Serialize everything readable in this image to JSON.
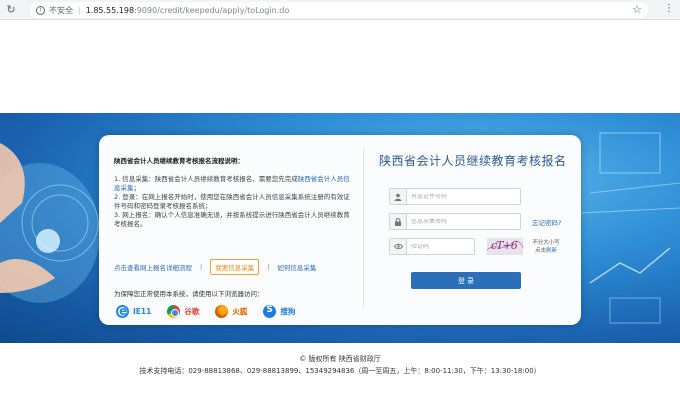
{
  "browser": {
    "security_label": "不安全",
    "url_host": "1.85.55.198",
    "url_path": ":9090/credit/keepedu/apply/toLogin.do"
  },
  "intro": {
    "title": "陕西省会计人员继续教育考核报名流程说明：",
    "steps": [
      {
        "text": "1. 信息采集：陕西省会计人员继续教育考核报名，需要您先完成",
        "link": "陕西省会计人员信息采集",
        "tail": "；"
      },
      {
        "text": "2. 登录：在网上报名开始时，使用您在陕西省会计人员信息采集系统注册的有效证件号码和密码登录考核报名系统；",
        "link": "",
        "tail": ""
      },
      {
        "text": "3. 网上报名：确认个人信息准确无误，并按系统提示进行陕西省会计人员继续教育考核报名。",
        "link": "",
        "tail": ""
      }
    ],
    "links": {
      "detail": "点击查看网上报名详细流程",
      "collect": "我要信息采集",
      "howto": "如何信息采集"
    },
    "browser_note": "为保障您正常使用本系统，请使用以下浏览器访问：",
    "browsers": [
      {
        "name": "IE11",
        "icon": "ie-icon"
      },
      {
        "name": "谷歌",
        "icon": "chrome-icon"
      },
      {
        "name": "火狐",
        "icon": "firefox-icon"
      },
      {
        "name": "搜狗",
        "icon": "sogou-icon"
      }
    ]
  },
  "login": {
    "title": "陕西省会计人员继续教育考核报名",
    "id_placeholder": "有效证件号码",
    "password_placeholder": "信息采集密码",
    "forgot": "忘记密码?",
    "captcha_placeholder": "验证码",
    "captcha_text": "cT+6",
    "captcha_hint": "不分大小写",
    "captcha_refresh_prefix": "点击",
    "captcha_refresh": "刷新",
    "submit": "登 录"
  },
  "footer": {
    "copyright": "© 版权所有 陕西省财政厅",
    "support": "技术支持电话：029-88813868、029-88813899、15349294836（周一至周五，上午：8:00-11:30，下午：13:30-18:00）"
  }
}
